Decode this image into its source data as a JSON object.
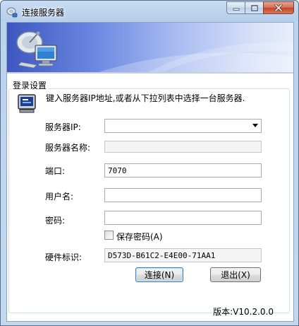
{
  "window": {
    "title": "连接服务器"
  },
  "group": {
    "title": "登录设置",
    "instruction": "键入服务器IP地址,或者从下拉列表中选择一台服务器."
  },
  "form": {
    "server_ip_label": "服务器IP:",
    "server_ip_value": "",
    "server_name_label": "服务器名称:",
    "server_name_value": "",
    "port_label": "端口:",
    "port_value": "7070",
    "username_label": "用户名:",
    "username_value": "",
    "password_label": "密码:",
    "password_value": "",
    "save_password_label": "保存密码(A)",
    "save_password_checked": false,
    "hardware_id_label": "硬件标识:",
    "hardware_id_value": "D573D-B61C2-E4E00-71AA1"
  },
  "buttons": {
    "connect": "连接(N)",
    "exit": "退出(X)"
  },
  "footer": {
    "version": "版本:V10.2.0.0"
  },
  "icons": {
    "app": "satellite-dish-icon",
    "banner": "satellite-computer-icon",
    "info": "computer-terminal-icon",
    "minimize": "minimize-icon",
    "maximize": "maximize-icon",
    "close": "close-icon",
    "dropdown": "chevron-down-icon"
  },
  "colors": {
    "banner_start": "#3d57c0",
    "banner_end": "#e8eefb",
    "default_button_border": "#3c7fb1",
    "close_button": "#c2442a"
  }
}
